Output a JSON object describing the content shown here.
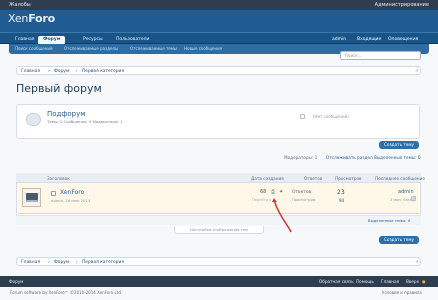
{
  "topbar": {
    "left": "Жалобы",
    "right": "Администрирование"
  },
  "logo": {
    "part1": "Xen",
    "part2": "Foro"
  },
  "tabs": [
    {
      "label": "Главная"
    },
    {
      "label": "Форум"
    },
    {
      "label": "Ресурсы"
    },
    {
      "label": "Пользователи"
    }
  ],
  "user_links": {
    "user": "admin",
    "inbox": "Входящие",
    "alerts": "Оповещения"
  },
  "subnav": [
    "Поиск сообщений",
    "Отслеживаемые разделы",
    "Отслеживаемые темы",
    "Новые сообщения"
  ],
  "search": {
    "placeholder": "Поиск..."
  },
  "breadcrumb": [
    "Главная",
    "Форум",
    "Первая категория"
  ],
  "page_title": "Первый форум",
  "subforum": {
    "title": "Подфорум",
    "stats": "Темы: 0 Сообщения: 0 Модераторы: 1",
    "status": "(Нет сообщений)"
  },
  "buttons": {
    "create_topic": "Создать тему"
  },
  "moderation": {
    "moderators": "Модераторы: 1",
    "watch": "Отслеживать раздел",
    "selected": "Выделенные темы: 0"
  },
  "table": {
    "headers": [
      "Заголовок",
      "Дата создания",
      "Ответов",
      "Просмотров",
      "Последнее сообщение"
    ],
    "row": {
      "title": "XenForo",
      "meta": "admin, 26 июл 2014",
      "date": "68",
      "page_hint": "Перейти к ...",
      "replies_label": "Ответов:",
      "replies": "23",
      "views_label": "Просмотров:",
      "views": "94",
      "last_user": "admin",
      "last_time": "2 мин. назад"
    },
    "selected": "Выделенные темы: 0",
    "footer": "Настройки отображения тем"
  },
  "footer": {
    "left": "Форум",
    "links": [
      "Обратная связь",
      "Помощь",
      "Главная",
      "Вверх"
    ],
    "copyright": "Forum software by XenForo™ ©2010-2014 XenForo Ltd.",
    "terms": "Условия и правила"
  },
  "colors": {
    "header": "#1e5c93",
    "accent": "#2f6fa8",
    "arrow": "#c93a3a",
    "highlight_row": "#fff8e8"
  }
}
